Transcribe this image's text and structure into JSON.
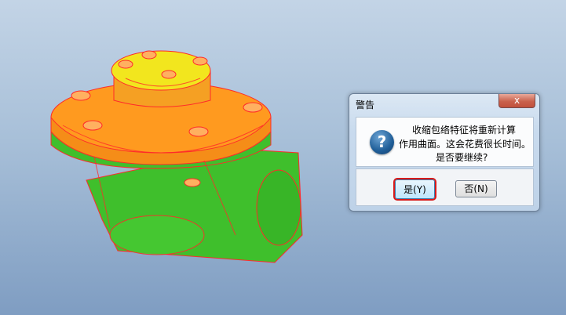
{
  "dialog": {
    "title": "警告",
    "close_label": "x",
    "icon": "question-icon",
    "message_lines": [
      "收缩包络特征将重新计算",
      "作用曲面。这会花费很长时间。",
      "是否要继续?"
    ],
    "yes_label": "是(Y)",
    "no_label": "否(N)"
  },
  "colors": {
    "model_green": "#3fc22b",
    "model_orange": "#ff9a1f",
    "model_yellow": "#f2e61e",
    "wire_red": "#ff2020",
    "focus_red": "#d81b1b"
  }
}
